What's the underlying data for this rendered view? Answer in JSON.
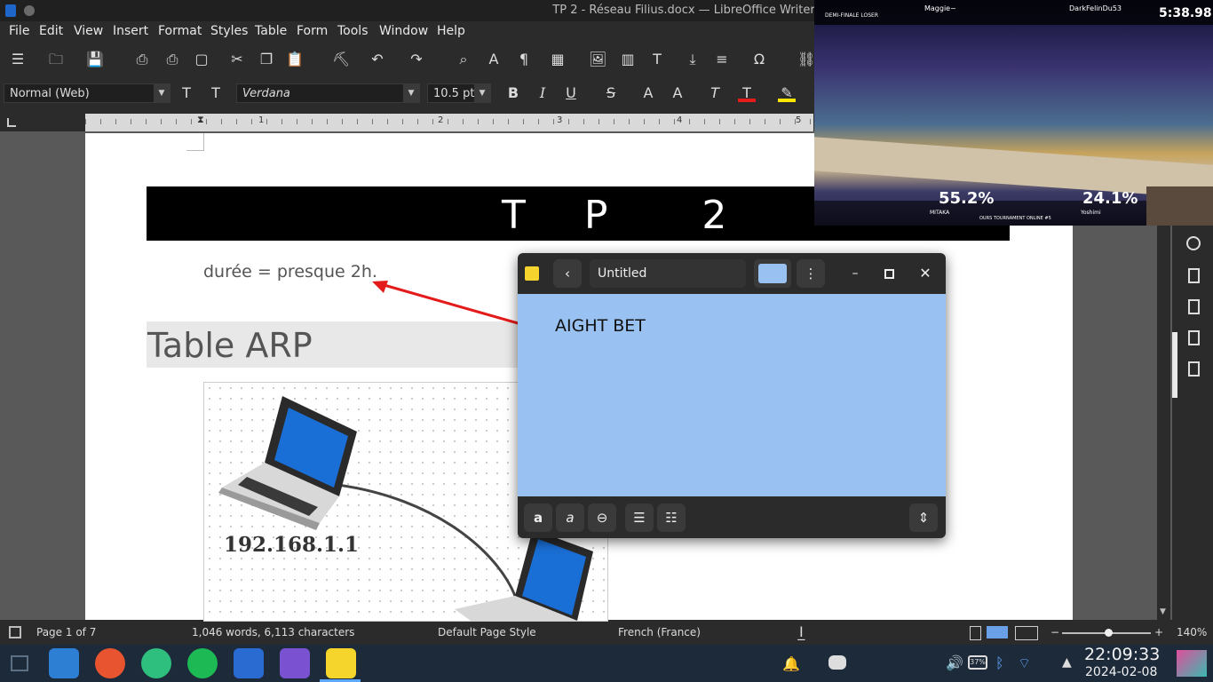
{
  "window": {
    "title": "TP 2 - Réseau Filius.docx — LibreOffice Writer"
  },
  "menu": [
    "File",
    "Edit",
    "View",
    "Insert",
    "Format",
    "Styles",
    "Table",
    "Form",
    "Tools",
    "Window",
    "Help"
  ],
  "format_toolbar": {
    "paragraph_style": "Normal (Web)",
    "font_name": "Verdana",
    "font_size": "10.5 pt"
  },
  "ruler": {
    "numbers": [
      "1",
      "2",
      "3",
      "4",
      "5"
    ]
  },
  "document": {
    "banner": "T P  2",
    "duration_text": "durée = presque 2h.",
    "heading": "Table ARP",
    "diagram_ip": "192.168.1.1"
  },
  "statusbar": {
    "page": "Page 1 of 7",
    "words": "1,046 words, 6,113 characters",
    "page_style": "Default Page Style",
    "language": "French (France)",
    "zoom": "140%"
  },
  "video": {
    "round": "DEMI-FINALE LOSER",
    "player1": "Maggie~",
    "player2": "DarkFelinDu53",
    "timer": "5:38.98",
    "p1_percent": "55.2%",
    "p2_percent": "24.1%",
    "p1_character": "MITAKA",
    "p2_character": "Yoshimi",
    "event": "OURS TOURNAMENT ONLINE #5"
  },
  "sticky_note": {
    "title": "Untitled",
    "content": "AIGHT BET",
    "color": "#99c1f1"
  },
  "taskbar": {
    "time": "22:09:33",
    "date": "2024-02-08",
    "battery": "37%"
  },
  "colors": {
    "accent_red": "#e31b1b",
    "note_blue": "#99c1f1",
    "taskbar": "#1c2a39"
  }
}
